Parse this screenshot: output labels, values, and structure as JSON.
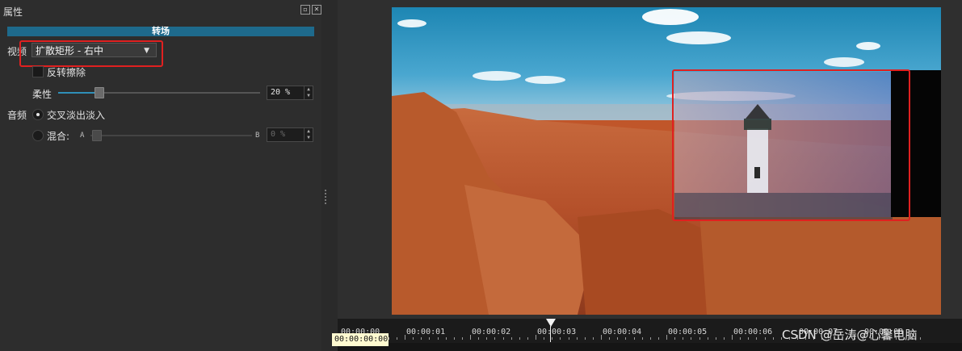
{
  "panel": {
    "title": "属性",
    "float_icon": "float-icon",
    "close_icon": "close-icon",
    "section_title": "转场"
  },
  "video": {
    "label": "视频",
    "transition_selected": "扩散矩形 - 右中",
    "invert_label": "反转擦除",
    "softness_label": "柔性",
    "softness_value": "20 %",
    "softness_percent": 20
  },
  "audio": {
    "label": "音频",
    "crossfade_label": "交叉淡出淡入",
    "mix_label": "混合:",
    "mix_a": "A",
    "mix_b": "B",
    "mix_value": "0 %",
    "mix_percent": 0
  },
  "timeline": {
    "current_timecode": "00:00:00:00",
    "ticks": [
      "00:00:00",
      "00:00:01",
      "00:00:02",
      "00:00:03",
      "00:00:04",
      "00:00:05",
      "00:00:06",
      "00:00:07",
      "00:00:08"
    ]
  },
  "watermark": "CSDN @岳涛@心馨电脑",
  "colors": {
    "accent": "#1e6a8c",
    "highlight": "#e02020"
  }
}
